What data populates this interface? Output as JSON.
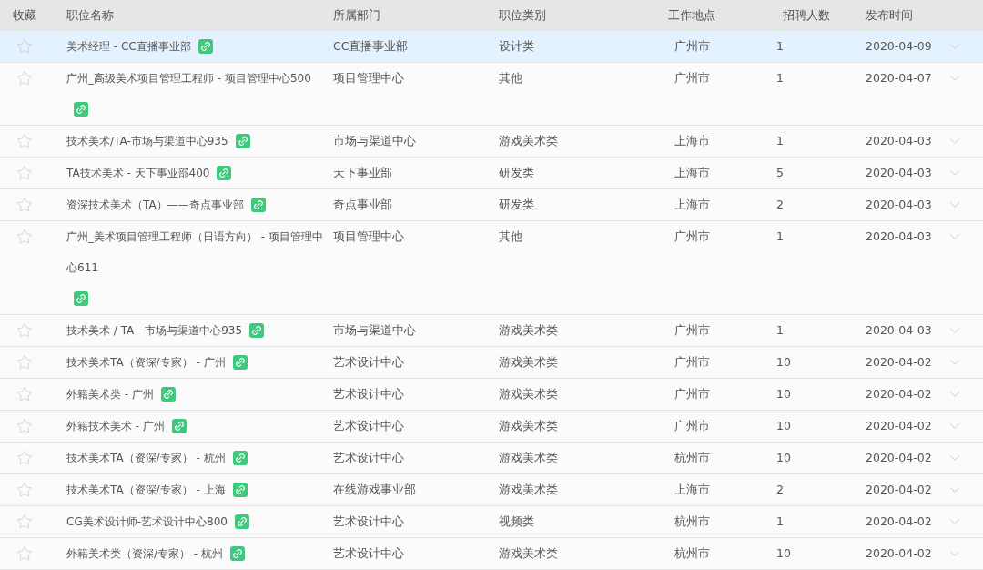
{
  "columns": [
    "收藏",
    "职位名称",
    "所属部门",
    "职位类别",
    "工作地点",
    "招聘人数",
    "发布时间"
  ],
  "rows": [
    {
      "favorited": false,
      "highlighted": true,
      "title": "美术经理 - CC直播事业部",
      "department": "CC直播事业部",
      "category": "设计类",
      "location": "广州市",
      "openings": "1",
      "date": "2020-04-09"
    },
    {
      "favorited": false,
      "highlighted": false,
      "title": "广州_高级美术项目管理工程师 - 项目管理中心500",
      "department": "项目管理中心",
      "category": "其他",
      "location": "广州市",
      "openings": "1",
      "date": "2020-04-07"
    },
    {
      "favorited": false,
      "highlighted": false,
      "title": "技术美术/TA-市场与渠道中心935",
      "department": "市场与渠道中心",
      "category": "游戏美术类",
      "location": "上海市",
      "openings": "1",
      "date": "2020-04-03"
    },
    {
      "favorited": false,
      "highlighted": false,
      "title": "TA技术美术 - 天下事业部400",
      "department": "天下事业部",
      "category": "研发类",
      "location": "上海市",
      "openings": "5",
      "date": "2020-04-03"
    },
    {
      "favorited": false,
      "highlighted": false,
      "title": "资深技术美术（TA）——奇点事业部",
      "department": "奇点事业部",
      "category": "研发类",
      "location": "上海市",
      "openings": "2",
      "date": "2020-04-03"
    },
    {
      "favorited": false,
      "highlighted": false,
      "title": "广州_美术项目管理工程师（日语方向） - 项目管理中心611",
      "department": "项目管理中心",
      "category": "其他",
      "location": "广州市",
      "openings": "1",
      "date": "2020-04-03"
    },
    {
      "favorited": false,
      "highlighted": false,
      "title": "技术美术 / TA - 市场与渠道中心935",
      "department": "市场与渠道中心",
      "category": "游戏美术类",
      "location": "广州市",
      "openings": "1",
      "date": "2020-04-03"
    },
    {
      "favorited": false,
      "highlighted": false,
      "title": "技术美术TA（资深/专家） - 广州",
      "department": "艺术设计中心",
      "category": "游戏美术类",
      "location": "广州市",
      "openings": "10",
      "date": "2020-04-02"
    },
    {
      "favorited": false,
      "highlighted": false,
      "title": "外籍美术类 - 广州",
      "department": "艺术设计中心",
      "category": "游戏美术类",
      "location": "广州市",
      "openings": "10",
      "date": "2020-04-02"
    },
    {
      "favorited": false,
      "highlighted": false,
      "title": "外籍技术美术 - 广州",
      "department": "艺术设计中心",
      "category": "游戏美术类",
      "location": "广州市",
      "openings": "10",
      "date": "2020-04-02"
    },
    {
      "favorited": false,
      "highlighted": false,
      "title": "技术美术TA（资深/专家） - 杭州",
      "department": "艺术设计中心",
      "category": "游戏美术类",
      "location": "杭州市",
      "openings": "10",
      "date": "2020-04-02"
    },
    {
      "favorited": false,
      "highlighted": false,
      "title": "技术美术TA（资深/专家） - 上海",
      "department": "在线游戏事业部",
      "category": "游戏美术类",
      "location": "上海市",
      "openings": "2",
      "date": "2020-04-02"
    },
    {
      "favorited": false,
      "highlighted": false,
      "title": "CG美术设计师-艺术设计中心800",
      "department": "艺术设计中心",
      "category": "视频类",
      "location": "杭州市",
      "openings": "1",
      "date": "2020-04-02"
    },
    {
      "favorited": false,
      "highlighted": false,
      "title": "外籍美术类（资深/专家） - 杭州",
      "department": "艺术设计中心",
      "category": "游戏美术类",
      "location": "杭州市",
      "openings": "10",
      "date": "2020-04-02"
    }
  ]
}
